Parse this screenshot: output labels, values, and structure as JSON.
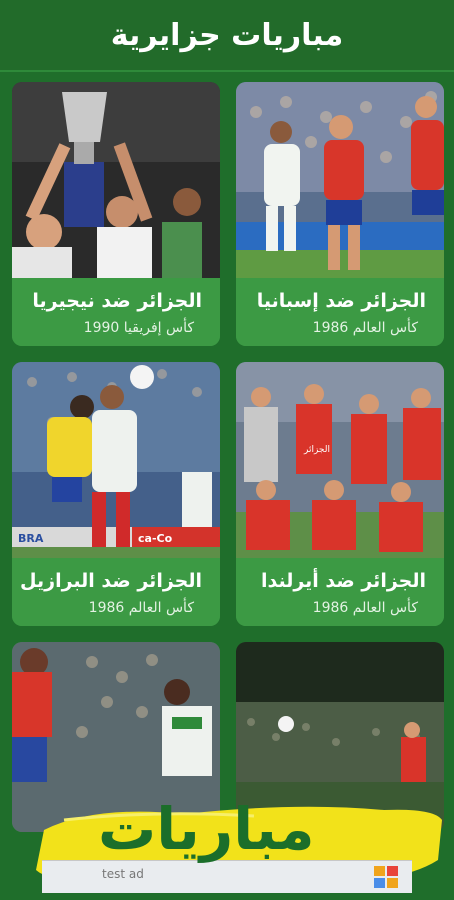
{
  "header": {
    "title": "مباريات جزايرية"
  },
  "cards": [
    {
      "title": "الجزائر ضد إسبانيا",
      "subtitle": "كأس العالم 1986"
    },
    {
      "title": "الجزائر ضد نيجيريا",
      "subtitle": "كأس إفريقيا 1990"
    },
    {
      "title": "الجزائر ضد أيرلندا",
      "subtitle": "كأس العالم 1986"
    },
    {
      "title": "الجزائر ضد البرازيل",
      "subtitle": "كأس العالم 1986"
    }
  ],
  "photo_texts": {
    "stadium_ad": "BRA",
    "ad_board": "ca-Co",
    "jersey_text": "الجزائر"
  },
  "banner": {
    "text": "مباريات"
  },
  "ad": {
    "text": "test ad"
  },
  "colors": {
    "app_green": "#1f6e2b",
    "card_green": "#3c9a44",
    "banner_yellow": "#f2e21a"
  }
}
